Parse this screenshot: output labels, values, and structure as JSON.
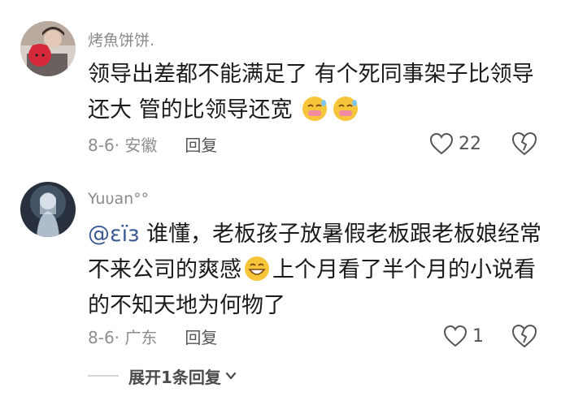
{
  "comments": [
    {
      "username": "烤魚饼饼.",
      "text_part1": "领导出差都不能满足了 有个死同事架子比领导还大 管的比领导还宽",
      "emoji": "face-with-grin-emoji",
      "date": "8-6· 安徽",
      "reply_label": "回复",
      "like_count": "22"
    },
    {
      "username": "Yuυan°°",
      "mention": "@εїз",
      "text_part1": " 谁懂，老板孩子放暑假老板跟老板娘经常不来公司的爽感",
      "emoji": "grinning-face-emoji",
      "text_part2": "上个月看了半个月的小说看的不知天地为何物了",
      "date": "8-6· 广东",
      "reply_label": "回复",
      "like_count": "1"
    }
  ],
  "expand_replies_label": "展开1条回复",
  "colors": {
    "mention": "#3c5a93",
    "meta_text": "#8e8e8e",
    "emoji_face": "#f7c53a"
  }
}
